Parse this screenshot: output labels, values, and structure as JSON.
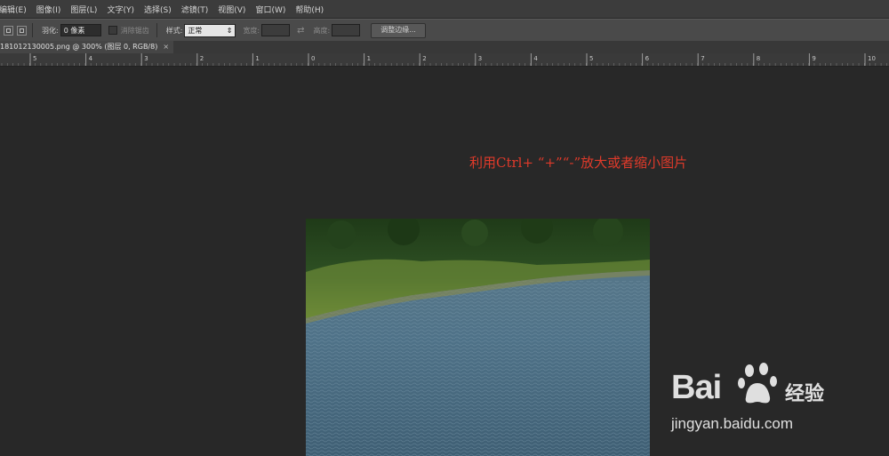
{
  "menu": [
    "编辑(E)",
    "图像(I)",
    "图层(L)",
    "文字(Y)",
    "选择(S)",
    "滤镜(T)",
    "视图(V)",
    "窗口(W)",
    "帮助(H)"
  ],
  "options": {
    "feather_label": "羽化:",
    "feather_value": "0 像素",
    "antialias_label": "消除锯齿",
    "style_label": "样式:",
    "style_value": "正常",
    "width_label": "宽度:",
    "height_label": "高度:",
    "refine_edge": "调整边缘..."
  },
  "document_tab": {
    "title": "181012130005.png @ 300% (图层 0, RGB/8)",
    "close": "×"
  },
  "ruler_labels": [
    "5",
    "4",
    "3",
    "2",
    "1",
    "0",
    "1",
    "2",
    "3",
    "4",
    "5",
    "6",
    "7",
    "8",
    "9",
    "10"
  ],
  "caption": "利用Ctrl+ “+”“-”放大或者缩小图片",
  "watermark": {
    "logo": "Bai",
    "cn": "经验",
    "url": "jingyan.baidu.com"
  },
  "colors": {
    "caption": "#e03a2a",
    "workspace": "#282828",
    "menubar": "#3c3c3c",
    "optionbar": "#4a4a4a"
  }
}
